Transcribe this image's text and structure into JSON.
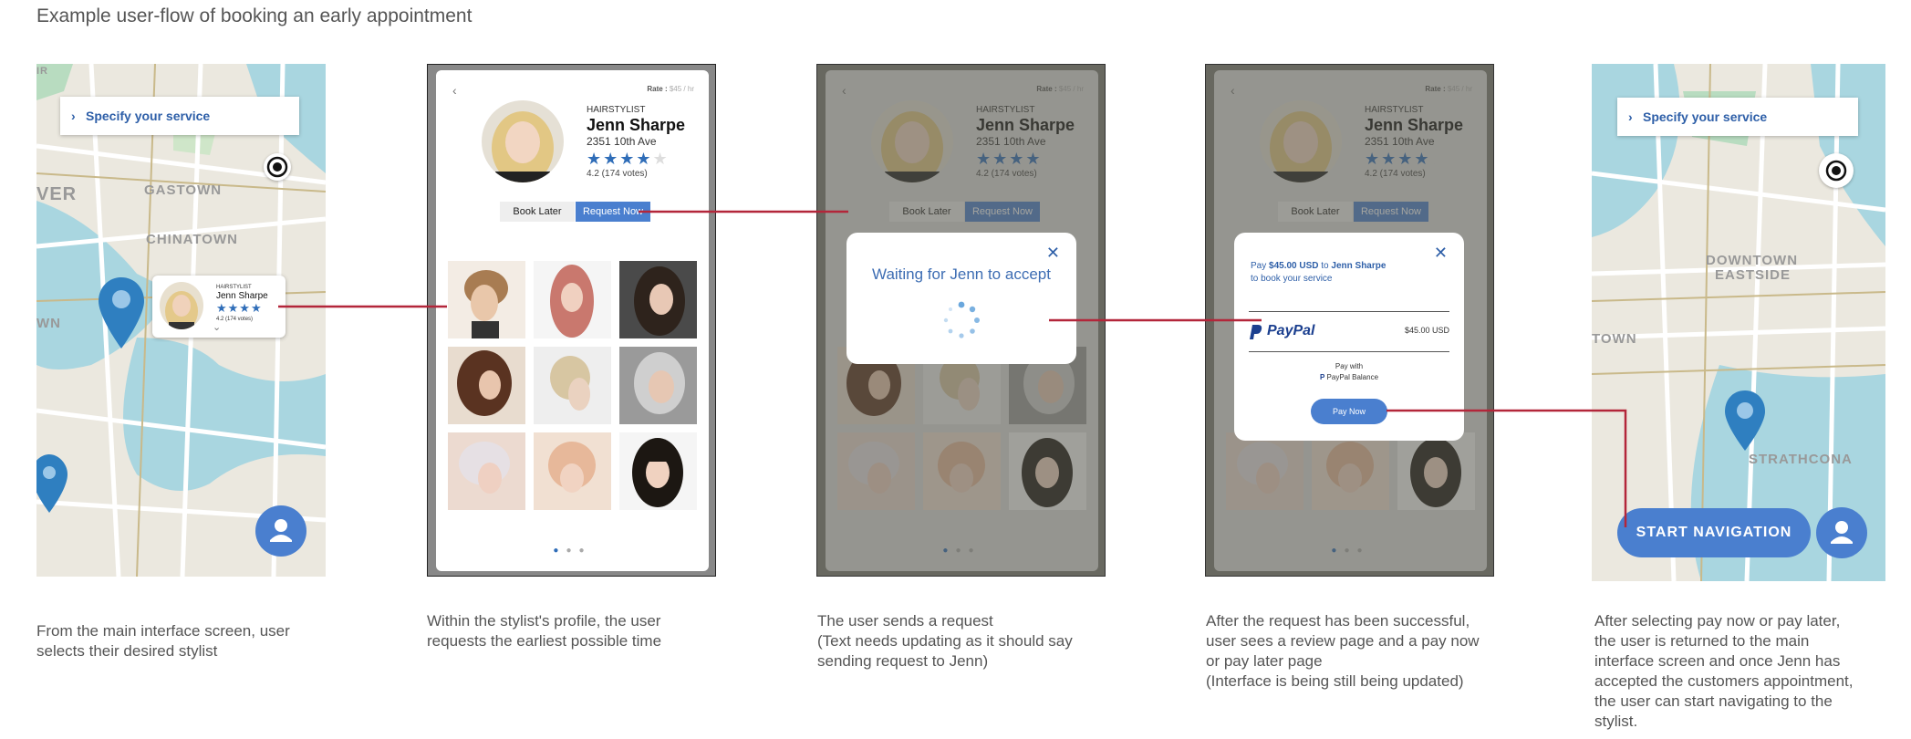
{
  "heading": "Example user-flow of booking an early appointment",
  "colors": {
    "accent": "#4a7fcf",
    "connector": "#b3263a",
    "star": "#2f6db8"
  },
  "screen1": {
    "specify": "Specify your service",
    "labels": [
      "GASTOWN",
      "CHINATOWN",
      "VER",
      "WN",
      "IR"
    ],
    "mini": {
      "title": "HAIRSTYLIST",
      "name": "Jenn Sharpe",
      "votes": "4.2 (174 votes)"
    }
  },
  "profile": {
    "rate_label": "Rate :",
    "rate_value": "$45 / hr",
    "title": "HAIRSTYLIST",
    "name": "Jenn Sharpe",
    "address": "2351 10th Ave",
    "votes": "4.2 (174 votes)",
    "book_later": "Book Later",
    "request_now": "Request Now",
    "back_icon": "chevron-left-icon"
  },
  "screen3": {
    "waiting": "Waiting for Jenn to accept",
    "close": "✕"
  },
  "screen4": {
    "pay_prefix": "Pay",
    "amount": "$45.00 USD",
    "to": "to",
    "name": "Jenn Sharpe",
    "pay_suffix": "to book your service",
    "paypal": "PayPal",
    "paypal_amount": "$45.00 USD",
    "pay_with": "Pay with",
    "balance": "PayPal Balance",
    "pay_now": "Pay Now",
    "close": "✕"
  },
  "screen5": {
    "specify": "Specify your service",
    "labels": [
      "DOWNTOWN",
      "EASTSIDE",
      "TOWN",
      "STRATHCONA"
    ],
    "start_navigation": "START NAVIGATION"
  },
  "descriptions": [
    [
      "From the main interface screen, user",
      "selects their desired stylist"
    ],
    [
      "Within the stylist's profile, the user",
      "requests the earliest possible time"
    ],
    [
      "The user sends a request",
      "(Text needs updating as it should say",
      "sending request to Jenn)"
    ],
    [
      "After the request has been successful,",
      "user sees a review page and a pay now",
      "or pay later page",
      "(Interface is being still being updated)"
    ],
    [
      "After selecting pay now or pay later,",
      "the user is returned to the main",
      "interface screen and once Jenn has",
      "accepted the customers appointment,",
      "the user can start navigating to the",
      "stylist."
    ]
  ]
}
